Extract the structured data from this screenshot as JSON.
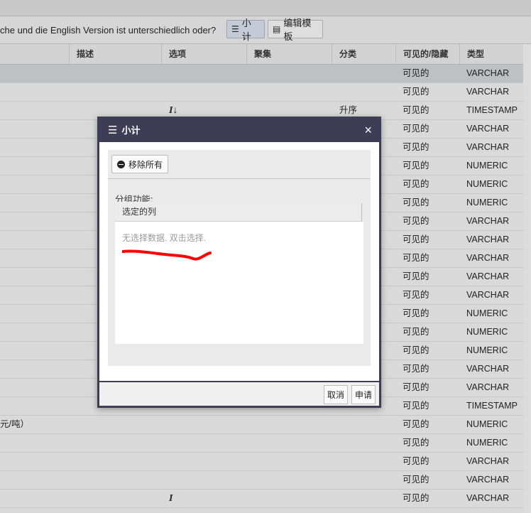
{
  "toolbar": {
    "question_text": "che und die English Version ist unterschiedlich oder?",
    "subtotal_label": "小计",
    "edit_template_label": "编辑模板"
  },
  "grid": {
    "headers": {
      "description": "描述",
      "options": "选项",
      "aggregate": "聚集",
      "category": "分类",
      "visibility": "可见的/隐藏",
      "type": "类型"
    },
    "rows": [
      {
        "desc": "",
        "opt": "",
        "cat": "",
        "vis": "可见的",
        "type": "VARCHAR"
      },
      {
        "desc": "",
        "opt": "",
        "cat": "",
        "vis": "可见的",
        "type": "VARCHAR"
      },
      {
        "desc": "",
        "opt": "I↓",
        "cat": "升序",
        "vis": "可见的",
        "type": "TIMESTAMP"
      },
      {
        "desc": "",
        "opt": "",
        "cat": "",
        "vis": "可见的",
        "type": "VARCHAR"
      },
      {
        "desc": "",
        "opt": "",
        "cat": "",
        "vis": "可见的",
        "type": "VARCHAR"
      },
      {
        "desc": "",
        "opt": "",
        "cat": "",
        "vis": "可见的",
        "type": "NUMERIC"
      },
      {
        "desc": "",
        "opt": "",
        "cat": "",
        "vis": "可见的",
        "type": "NUMERIC"
      },
      {
        "desc": "",
        "opt": "",
        "cat": "",
        "vis": "可见的",
        "type": "NUMERIC"
      },
      {
        "desc": "",
        "opt": "",
        "cat": "",
        "vis": "可见的",
        "type": "VARCHAR"
      },
      {
        "desc": "",
        "opt": "",
        "cat": "",
        "vis": "可见的",
        "type": "VARCHAR"
      },
      {
        "desc": "",
        "opt": "",
        "cat": "",
        "vis": "可见的",
        "type": "VARCHAR"
      },
      {
        "desc": "",
        "opt": "",
        "cat": "",
        "vis": "可见的",
        "type": "VARCHAR"
      },
      {
        "desc": "",
        "opt": "",
        "cat": "",
        "vis": "可见的",
        "type": "VARCHAR"
      },
      {
        "desc": "",
        "opt": "",
        "cat": "",
        "vis": "可见的",
        "type": "NUMERIC"
      },
      {
        "desc": "",
        "opt": "",
        "cat": "",
        "vis": "可见的",
        "type": "NUMERIC"
      },
      {
        "desc": "",
        "opt": "",
        "cat": "",
        "vis": "可见的",
        "type": "NUMERIC"
      },
      {
        "desc": "",
        "opt": "",
        "cat": "",
        "vis": "可见的",
        "type": "VARCHAR"
      },
      {
        "desc": "",
        "opt": "",
        "cat": "",
        "vis": "可见的",
        "type": "VARCHAR"
      },
      {
        "desc": "",
        "opt": "",
        "cat": "",
        "vis": "可见的",
        "type": "TIMESTAMP"
      },
      {
        "desc": "元/吨）",
        "opt": "",
        "cat": "",
        "vis": "可见的",
        "type": "NUMERIC"
      },
      {
        "desc": "",
        "opt": "",
        "cat": "",
        "vis": "可见的",
        "type": "NUMERIC"
      },
      {
        "desc": "",
        "opt": "",
        "cat": "",
        "vis": "可见的",
        "type": "VARCHAR"
      },
      {
        "desc": "",
        "opt": "",
        "cat": "",
        "vis": "可见的",
        "type": "VARCHAR"
      },
      {
        "desc": "",
        "opt": "I",
        "cat": "",
        "vis": "可见的",
        "type": "VARCHAR"
      }
    ]
  },
  "modal": {
    "title": "小计",
    "close_symbol": "×",
    "remove_all_label": "移除所有",
    "group_label": "分组功能:",
    "selected_columns_header": "选定的列",
    "empty_message": "无选择数据. 双击选择.",
    "cancel_label": "取消",
    "apply_label": "申请",
    "annotation_color": "#ff0000"
  }
}
